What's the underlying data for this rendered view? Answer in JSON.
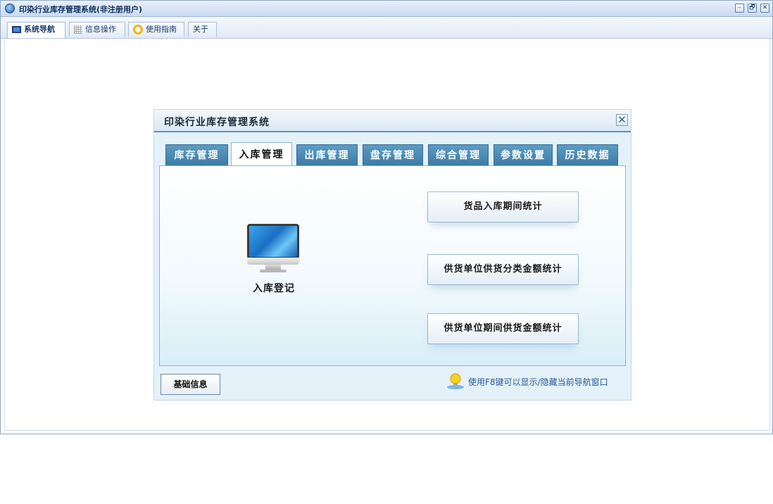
{
  "window": {
    "title": "印染行业库存管理系统(非注册用户)",
    "controls": [
      "–",
      "🗗",
      "✕"
    ]
  },
  "nav": {
    "tabs": [
      {
        "label": "系统导航",
        "icon": "monitor-icon",
        "active": true
      },
      {
        "label": "信息操作",
        "icon": "grid-icon",
        "active": false
      },
      {
        "label": "使用指南",
        "icon": "ring-icon",
        "active": false
      },
      {
        "label": "关于",
        "icon": "",
        "active": false
      }
    ]
  },
  "dialog": {
    "title": "印染行业库存管理系统",
    "close_glyph": "✕",
    "tabs": [
      "库存管理",
      "入库管理",
      "出库管理",
      "盘存管理",
      "综合管理",
      "参数设置",
      "历史数据"
    ],
    "active_tab": "入库管理",
    "entry_label": "入库登记",
    "buttons": [
      "货品入库期间统计",
      "供货单位供货分类金额统计",
      "供货单位期间供货金额统计"
    ],
    "basic_info_button": "基础信息",
    "tip": "使用F8键可以显示/隐藏当前导航窗口"
  },
  "colors": {
    "tab_blue": "#4a8bb5",
    "dialog_bg": "#e4f1f8",
    "tip_text": "#245a9c"
  }
}
